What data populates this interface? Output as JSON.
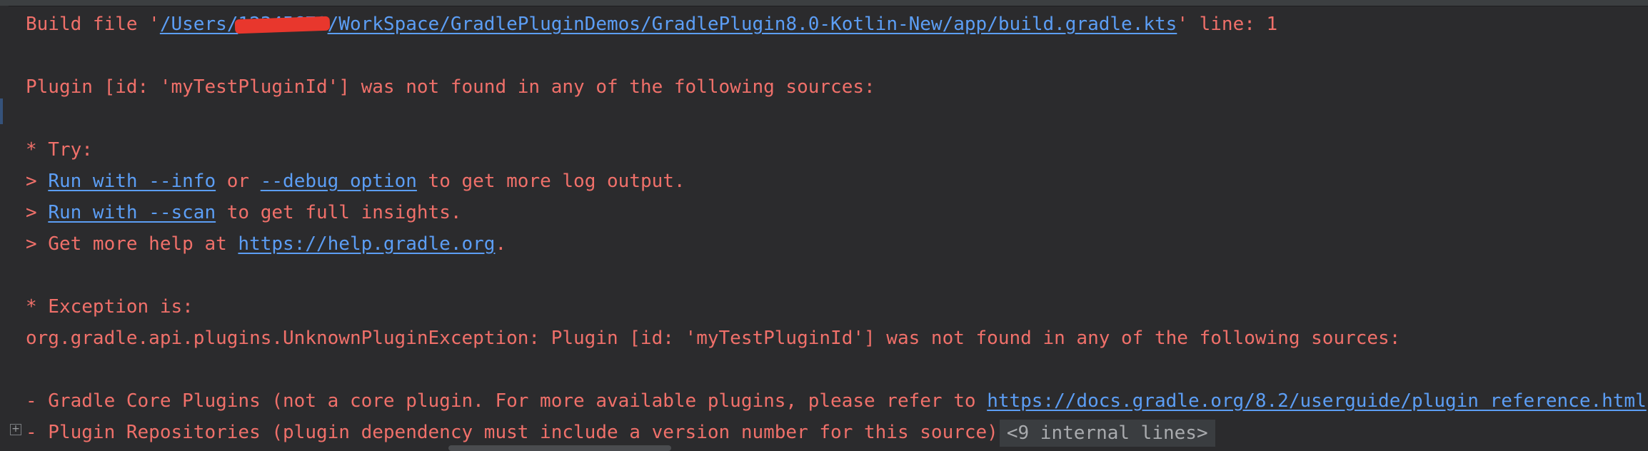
{
  "console": {
    "line1": {
      "prefix": "Build file '",
      "path_part1": "/Users/",
      "path_redacted": "12345678",
      "path_part2": "/WorkSpace/GradlePluginDemos/GradlePlugin8.0-Kotlin-New/app/build.gradle.kts",
      "suffix": "' line: 1"
    },
    "line3": "Plugin [id: 'myTestPluginId'] was not found in any of the following sources:",
    "line5": "* Try:",
    "line6": {
      "prefix": "> ",
      "link1": "Run with --info",
      "mid": " or ",
      "link2": "--debug option",
      "suffix": " to get more log output."
    },
    "line7": {
      "prefix": "> ",
      "link": "Run with --scan",
      "suffix": " to get full insights."
    },
    "line8": {
      "prefix": "> Get more help at ",
      "link": "https://help.gradle.org",
      "suffix": "."
    },
    "line10": "* Exception is:",
    "line11": "org.gradle.api.plugins.UnknownPluginException: Plugin [id: 'myTestPluginId'] was not found in any of the following sources:",
    "line13": {
      "prefix": "- Gradle Core Plugins (not a core plugin. For more available plugins, please refer to ",
      "link": "https://docs.gradle.org/8.2/userguide/plugin_reference.html"
    },
    "line14": {
      "text": "- Plugin Repositories (plugin dependency must include a version number for this source)",
      "folded": "<9 internal lines>"
    }
  },
  "icons": {
    "fold": "expand-fold-icon"
  },
  "colors": {
    "background": "#2b2b2d",
    "error_text": "#f0706a",
    "link": "#5c9ef5",
    "folded_bg": "#3a3d40"
  }
}
